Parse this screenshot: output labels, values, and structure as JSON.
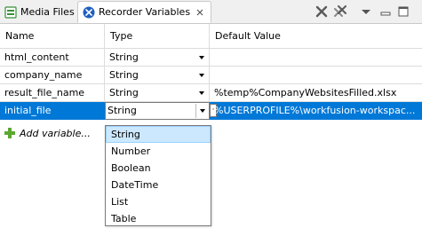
{
  "tabs": [
    {
      "label": "Media Files",
      "icon": "media-files-icon",
      "active": false
    },
    {
      "label": "Recorder Variables",
      "icon": "recorder-icon",
      "active": true
    }
  ],
  "toolbar": {
    "remove_icon": "remove-x-icon",
    "remove_all_icon": "remove-all-icon",
    "menu_icon": "view-menu-icon",
    "minimize_icon": "minimize-icon",
    "maximize_icon": "maximize-icon"
  },
  "table": {
    "columns": [
      "Name",
      "Type",
      "Default Value"
    ],
    "rows": [
      {
        "name": "html_content",
        "type": "String",
        "default": ""
      },
      {
        "name": "company_name",
        "type": "String",
        "default": ""
      },
      {
        "name": "result_file_name",
        "type": "String",
        "default": "%temp%CompanyWebsitesFilled.xlsx"
      },
      {
        "name": "initial_file",
        "type": "String",
        "default": "%USERPROFILE%\\workfusion-workspac..."
      }
    ],
    "add_label": "Add variable..."
  },
  "type_dropdown": {
    "selected": "String",
    "options": [
      "String",
      "Number",
      "Boolean",
      "DateTime",
      "List",
      "Table"
    ]
  },
  "colors": {
    "selection": "#0078d7",
    "dropdown_highlight": "#cce8ff"
  }
}
